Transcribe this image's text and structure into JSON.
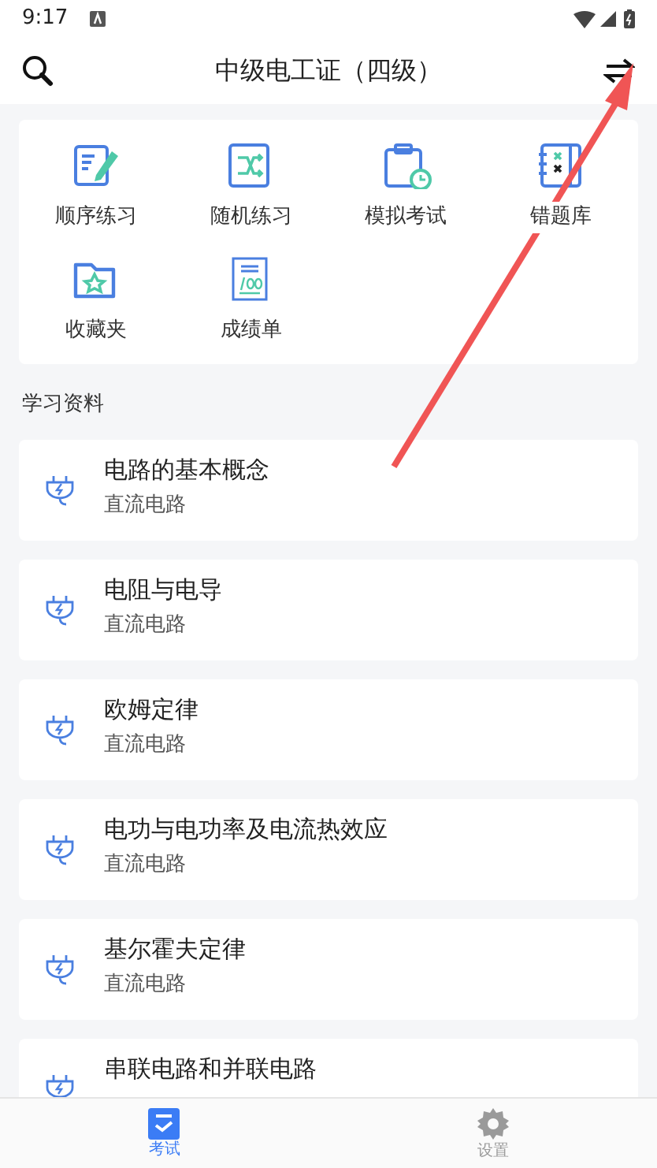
{
  "status_bar": {
    "time": "9:17"
  },
  "header": {
    "title": "中级电工证（四级）"
  },
  "features": [
    {
      "label": "顺序练习",
      "kind": "edit"
    },
    {
      "label": "随机练习",
      "kind": "shuffle"
    },
    {
      "label": "模拟考试",
      "kind": "exam"
    },
    {
      "label": "错题库",
      "kind": "wrong"
    },
    {
      "label": "收藏夹",
      "kind": "folder"
    },
    {
      "label": "成绩单",
      "kind": "score"
    }
  ],
  "section_title": "学习资料",
  "materials": [
    {
      "title": "电路的基本概念",
      "subtitle": "直流电路"
    },
    {
      "title": "电阻与电导",
      "subtitle": "直流电路"
    },
    {
      "title": "欧姆定律",
      "subtitle": "直流电路"
    },
    {
      "title": "电功与电功率及电流热效应",
      "subtitle": "直流电路"
    },
    {
      "title": "基尔霍夫定律",
      "subtitle": "直流电路"
    },
    {
      "title": "串联电路和并联电路"
    }
  ],
  "tabs": [
    {
      "label": "考试",
      "kind": "exam",
      "selected": true
    },
    {
      "label": "设置",
      "kind": "settings",
      "selected": false
    }
  ]
}
